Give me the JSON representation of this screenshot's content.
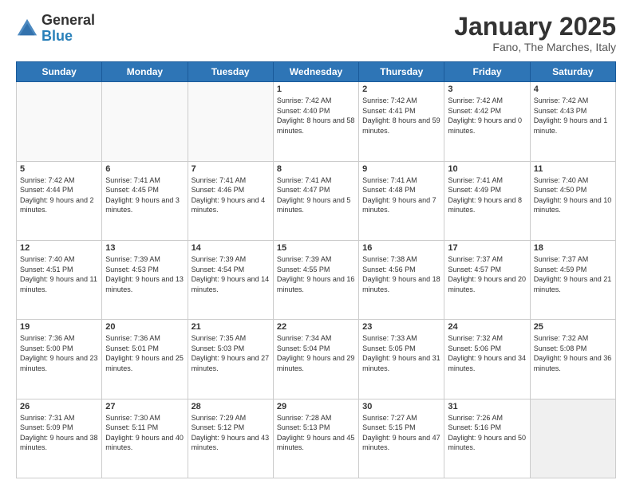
{
  "header": {
    "logo_general": "General",
    "logo_blue": "Blue",
    "month_title": "January 2025",
    "location": "Fano, The Marches, Italy"
  },
  "weekdays": [
    "Sunday",
    "Monday",
    "Tuesday",
    "Wednesday",
    "Thursday",
    "Friday",
    "Saturday"
  ],
  "weeks": [
    [
      {
        "day": "",
        "info": ""
      },
      {
        "day": "",
        "info": ""
      },
      {
        "day": "",
        "info": ""
      },
      {
        "day": "1",
        "info": "Sunrise: 7:42 AM\nSunset: 4:40 PM\nDaylight: 8 hours\nand 58 minutes."
      },
      {
        "day": "2",
        "info": "Sunrise: 7:42 AM\nSunset: 4:41 PM\nDaylight: 8 hours\nand 59 minutes."
      },
      {
        "day": "3",
        "info": "Sunrise: 7:42 AM\nSunset: 4:42 PM\nDaylight: 9 hours\nand 0 minutes."
      },
      {
        "day": "4",
        "info": "Sunrise: 7:42 AM\nSunset: 4:43 PM\nDaylight: 9 hours\nand 1 minute."
      }
    ],
    [
      {
        "day": "5",
        "info": "Sunrise: 7:42 AM\nSunset: 4:44 PM\nDaylight: 9 hours\nand 2 minutes."
      },
      {
        "day": "6",
        "info": "Sunrise: 7:41 AM\nSunset: 4:45 PM\nDaylight: 9 hours\nand 3 minutes."
      },
      {
        "day": "7",
        "info": "Sunrise: 7:41 AM\nSunset: 4:46 PM\nDaylight: 9 hours\nand 4 minutes."
      },
      {
        "day": "8",
        "info": "Sunrise: 7:41 AM\nSunset: 4:47 PM\nDaylight: 9 hours\nand 5 minutes."
      },
      {
        "day": "9",
        "info": "Sunrise: 7:41 AM\nSunset: 4:48 PM\nDaylight: 9 hours\nand 7 minutes."
      },
      {
        "day": "10",
        "info": "Sunrise: 7:41 AM\nSunset: 4:49 PM\nDaylight: 9 hours\nand 8 minutes."
      },
      {
        "day": "11",
        "info": "Sunrise: 7:40 AM\nSunset: 4:50 PM\nDaylight: 9 hours\nand 10 minutes."
      }
    ],
    [
      {
        "day": "12",
        "info": "Sunrise: 7:40 AM\nSunset: 4:51 PM\nDaylight: 9 hours\nand 11 minutes."
      },
      {
        "day": "13",
        "info": "Sunrise: 7:39 AM\nSunset: 4:53 PM\nDaylight: 9 hours\nand 13 minutes."
      },
      {
        "day": "14",
        "info": "Sunrise: 7:39 AM\nSunset: 4:54 PM\nDaylight: 9 hours\nand 14 minutes."
      },
      {
        "day": "15",
        "info": "Sunrise: 7:39 AM\nSunset: 4:55 PM\nDaylight: 9 hours\nand 16 minutes."
      },
      {
        "day": "16",
        "info": "Sunrise: 7:38 AM\nSunset: 4:56 PM\nDaylight: 9 hours\nand 18 minutes."
      },
      {
        "day": "17",
        "info": "Sunrise: 7:37 AM\nSunset: 4:57 PM\nDaylight: 9 hours\nand 20 minutes."
      },
      {
        "day": "18",
        "info": "Sunrise: 7:37 AM\nSunset: 4:59 PM\nDaylight: 9 hours\nand 21 minutes."
      }
    ],
    [
      {
        "day": "19",
        "info": "Sunrise: 7:36 AM\nSunset: 5:00 PM\nDaylight: 9 hours\nand 23 minutes."
      },
      {
        "day": "20",
        "info": "Sunrise: 7:36 AM\nSunset: 5:01 PM\nDaylight: 9 hours\nand 25 minutes."
      },
      {
        "day": "21",
        "info": "Sunrise: 7:35 AM\nSunset: 5:03 PM\nDaylight: 9 hours\nand 27 minutes."
      },
      {
        "day": "22",
        "info": "Sunrise: 7:34 AM\nSunset: 5:04 PM\nDaylight: 9 hours\nand 29 minutes."
      },
      {
        "day": "23",
        "info": "Sunrise: 7:33 AM\nSunset: 5:05 PM\nDaylight: 9 hours\nand 31 minutes."
      },
      {
        "day": "24",
        "info": "Sunrise: 7:32 AM\nSunset: 5:06 PM\nDaylight: 9 hours\nand 34 minutes."
      },
      {
        "day": "25",
        "info": "Sunrise: 7:32 AM\nSunset: 5:08 PM\nDaylight: 9 hours\nand 36 minutes."
      }
    ],
    [
      {
        "day": "26",
        "info": "Sunrise: 7:31 AM\nSunset: 5:09 PM\nDaylight: 9 hours\nand 38 minutes."
      },
      {
        "day": "27",
        "info": "Sunrise: 7:30 AM\nSunset: 5:11 PM\nDaylight: 9 hours\nand 40 minutes."
      },
      {
        "day": "28",
        "info": "Sunrise: 7:29 AM\nSunset: 5:12 PM\nDaylight: 9 hours\nand 43 minutes."
      },
      {
        "day": "29",
        "info": "Sunrise: 7:28 AM\nSunset: 5:13 PM\nDaylight: 9 hours\nand 45 minutes."
      },
      {
        "day": "30",
        "info": "Sunrise: 7:27 AM\nSunset: 5:15 PM\nDaylight: 9 hours\nand 47 minutes."
      },
      {
        "day": "31",
        "info": "Sunrise: 7:26 AM\nSunset: 5:16 PM\nDaylight: 9 hours\nand 50 minutes."
      },
      {
        "day": "",
        "info": ""
      }
    ]
  ]
}
